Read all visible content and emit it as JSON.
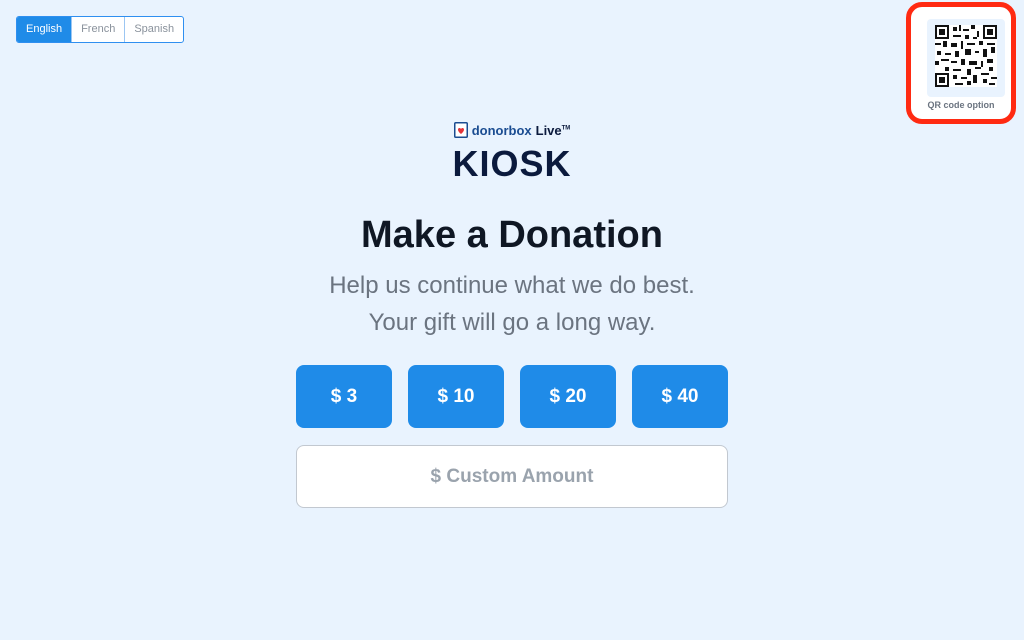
{
  "languages": [
    "English",
    "French",
    "Spanish"
  ],
  "selected_language": "English",
  "qr": {
    "label": "QR code option"
  },
  "brand": {
    "name": "donorbox",
    "live": "Live",
    "tm": "TM",
    "product": "KIOSK"
  },
  "heading": "Make a Donation",
  "subtitle_lines": [
    "Help us continue what we do best.",
    "Your gift will go a long way."
  ],
  "amounts": [
    "$ 3",
    "$ 10",
    "$ 20",
    "$ 40"
  ],
  "custom_amount_placeholder": "$ Custom Amount",
  "colors": {
    "primary": "#1f8be8",
    "highlight": "#ff2a12",
    "background": "#e9f3fe",
    "text_dark": "#0f1724"
  }
}
